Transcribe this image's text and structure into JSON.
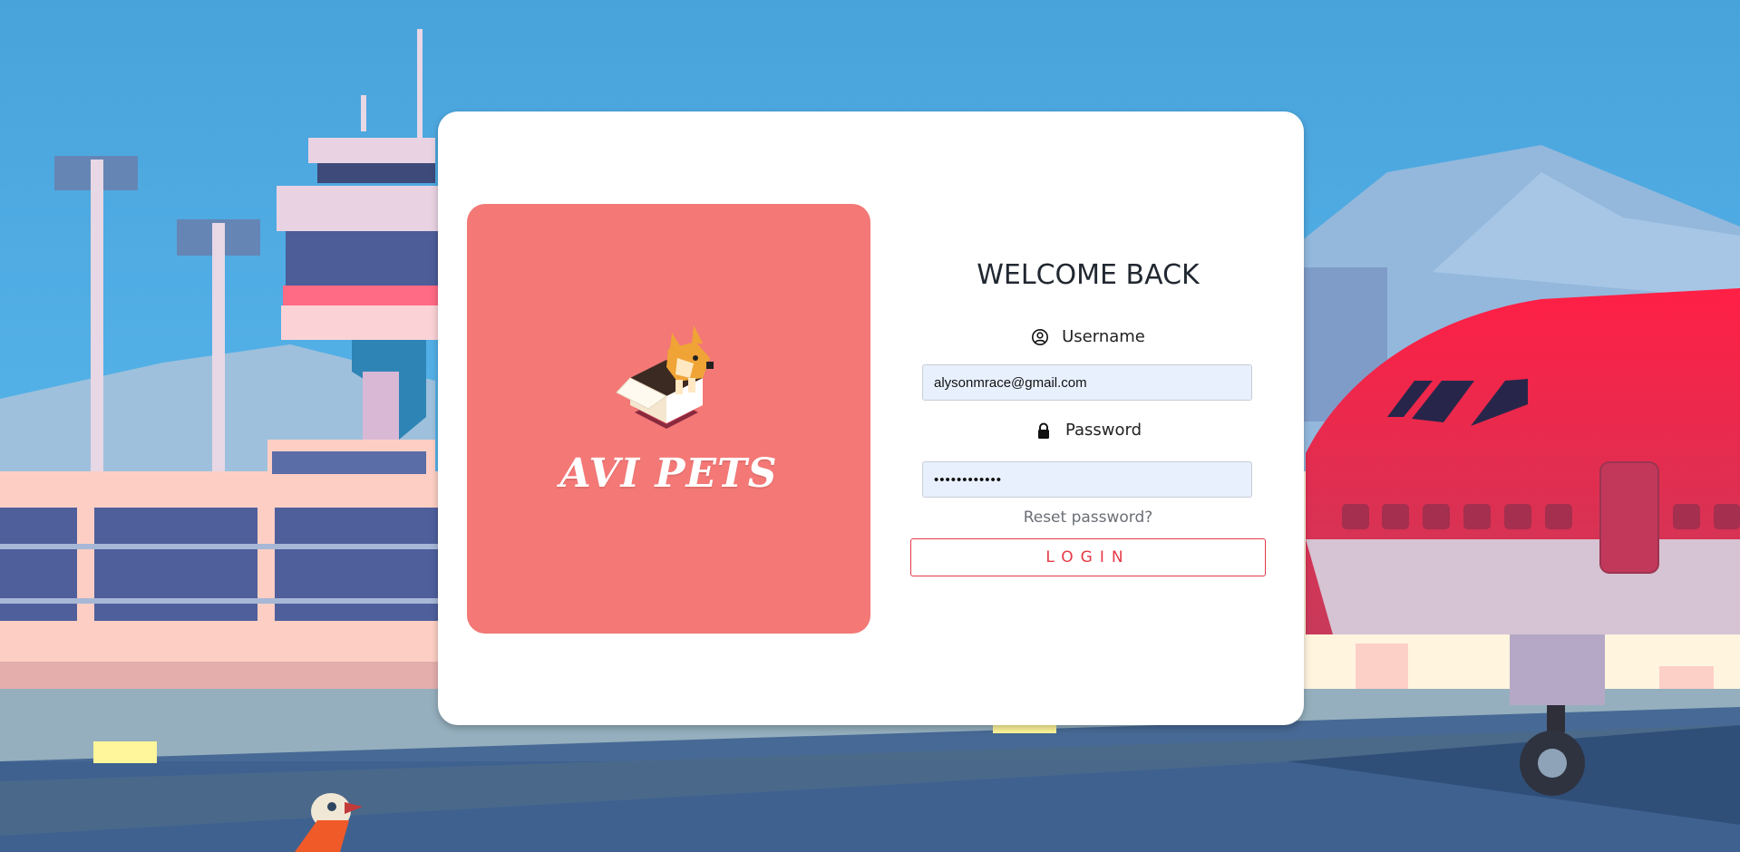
{
  "colors": {
    "sky": "#4aa9e0",
    "card_bg": "#ffffff",
    "logo_panel": "#f37876",
    "login_accent": "#e63946",
    "input_bg": "#e8f0fe"
  },
  "brand": {
    "name": "AVI PETS"
  },
  "login": {
    "title": "WELCOME BACK",
    "username_label": "Username",
    "username_icon": "user-circle-icon",
    "username_value": "alysonmrace@gmail.com",
    "password_label": "Password",
    "password_icon": "lock-icon",
    "password_value": "••••••••••••",
    "reset_link": "Reset password?",
    "login_button": "LOGIN"
  }
}
